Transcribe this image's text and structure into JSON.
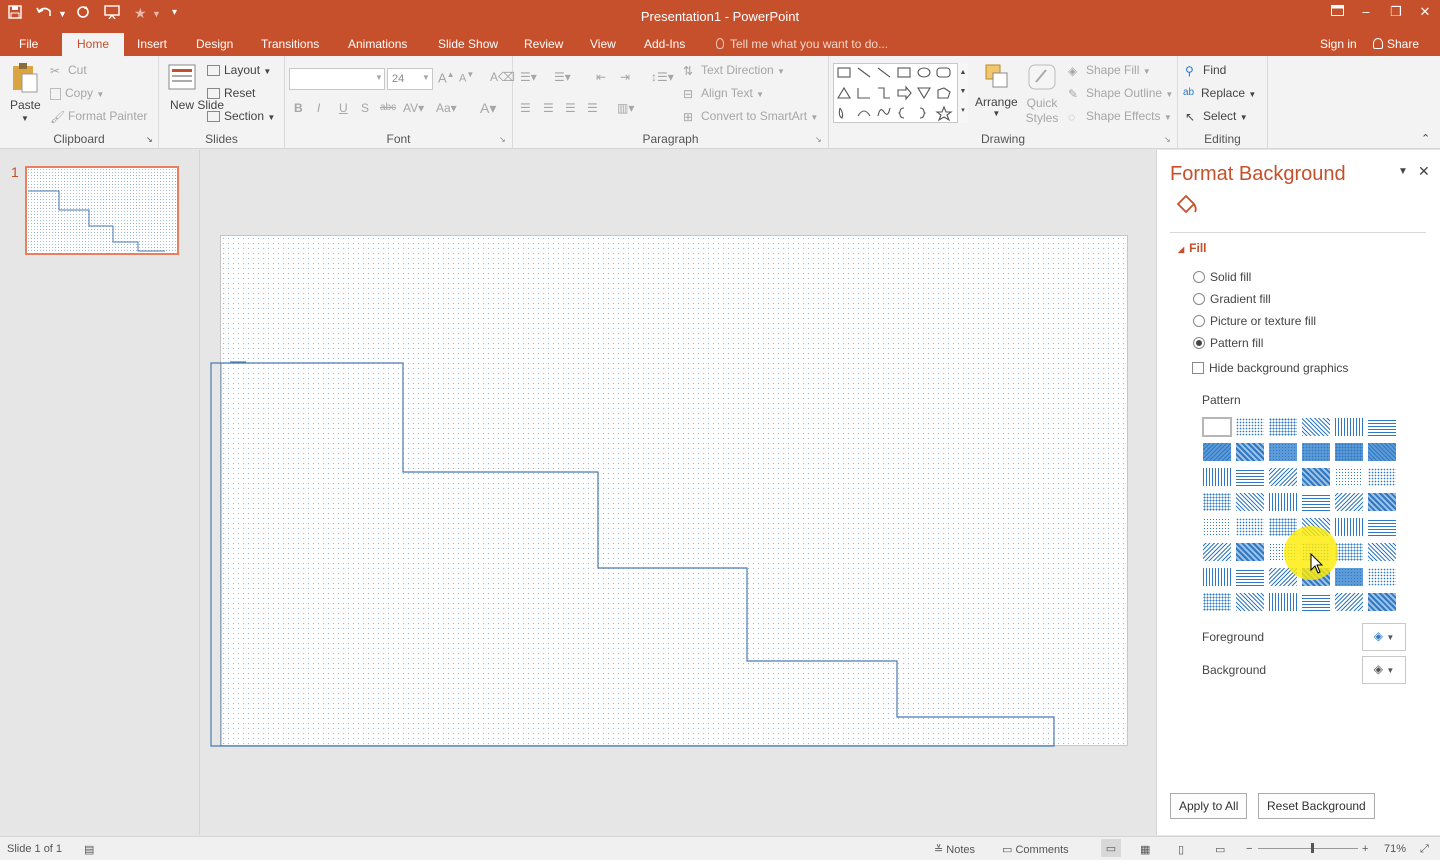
{
  "window": {
    "title": "Presentation1 - PowerPoint"
  },
  "quick_access": {
    "save_icon": "save-icon",
    "undo_icon": "undo-icon",
    "redo_icon": "repeat-icon",
    "present_icon": "present-icon"
  },
  "window_controls": {
    "restore_ribbon": "ribbon-display-icon",
    "minimize": "–",
    "maximize": "❐",
    "close": "✕"
  },
  "tabs": [
    "File",
    "Home",
    "Insert",
    "Design",
    "Transitions",
    "Animations",
    "Slide Show",
    "Review",
    "View",
    "Add-Ins"
  ],
  "active_tab": "Home",
  "tell_me": "Tell me what you want to do...",
  "account": {
    "sign_in": "Sign in",
    "share": "Share"
  },
  "ribbon": {
    "clipboard": {
      "label": "Clipboard",
      "paste": "Paste",
      "cut": "Cut",
      "copy": "Copy",
      "format_painter": "Format Painter"
    },
    "slides": {
      "label": "Slides",
      "new_slide": "New Slide",
      "layout": "Layout",
      "reset": "Reset",
      "section": "Section"
    },
    "font": {
      "label": "Font",
      "size": "24"
    },
    "paragraph": {
      "label": "Paragraph",
      "text_direction": "Text Direction",
      "align_text": "Align Text",
      "convert_smartart": "Convert to SmartArt"
    },
    "drawing": {
      "label": "Drawing",
      "arrange": "Arrange",
      "quick_styles": "Quick Styles",
      "shape_fill": "Shape Fill",
      "shape_outline": "Shape Outline",
      "shape_effects": "Shape Effects"
    },
    "editing": {
      "label": "Editing",
      "find": "Find",
      "replace": "Replace",
      "select": "Select"
    }
  },
  "slides_panel": {
    "slide_number": "1"
  },
  "format_background": {
    "title": "Format Background",
    "section": "Fill",
    "options": [
      {
        "label": "Solid fill",
        "selected": false
      },
      {
        "label": "Gradient fill",
        "selected": false
      },
      {
        "label": "Picture or texture fill",
        "selected": false
      },
      {
        "label": "Pattern fill",
        "selected": true
      }
    ],
    "hide_graphics": {
      "label": "Hide background graphics",
      "checked": false
    },
    "pattern_label": "Pattern",
    "foreground_label": "Foreground",
    "background_label": "Background",
    "apply_all": "Apply to All",
    "reset": "Reset Background"
  },
  "status": {
    "slide": "Slide 1 of 1",
    "notes": "Notes",
    "comments": "Comments",
    "zoom": "71%"
  },
  "colors": {
    "accent": "#c6502b",
    "pattern_blue": "#2f78c2",
    "line_blue": "#4a7ab0"
  }
}
